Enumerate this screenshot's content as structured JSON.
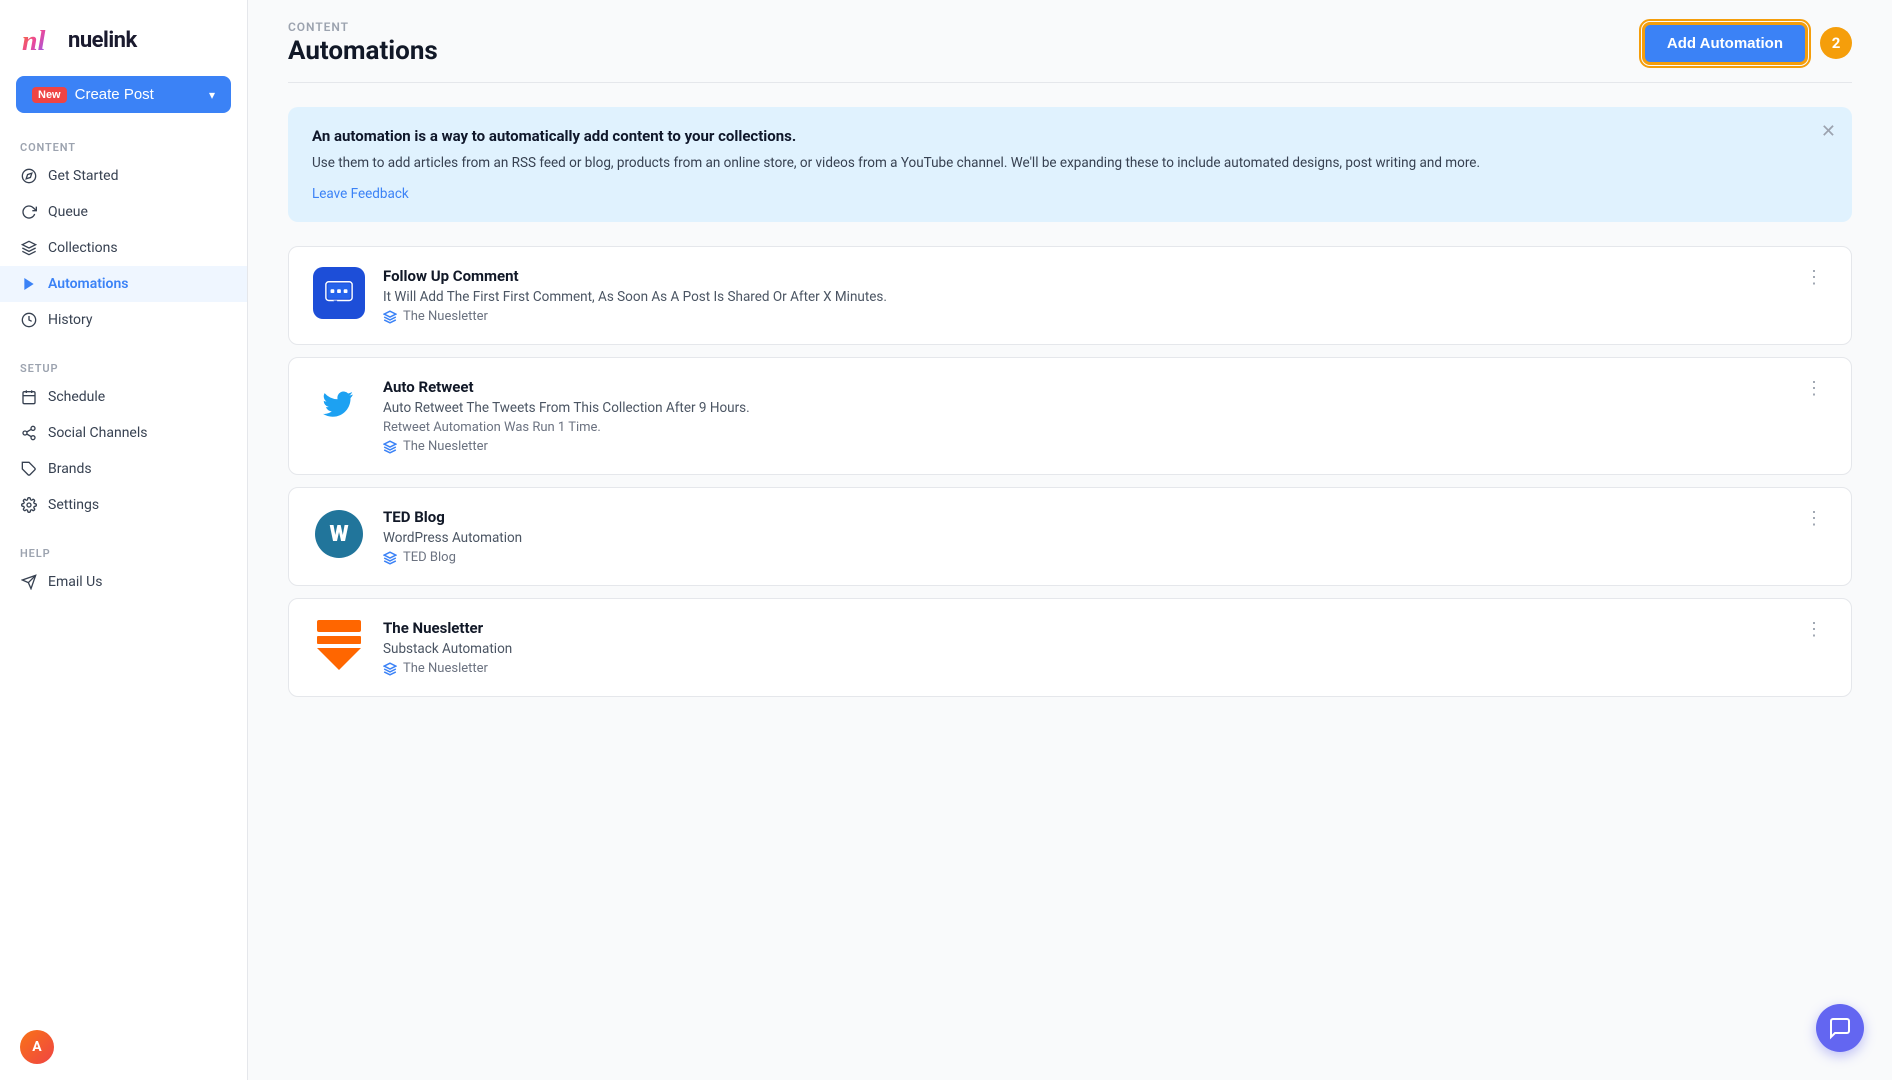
{
  "app": {
    "name": "nuelink",
    "logo_letters": "nl"
  },
  "sidebar": {
    "create_post_badge": "New",
    "create_post_label": "Create Post",
    "sections": [
      {
        "label": "CONTENT",
        "items": [
          {
            "id": "get-started",
            "label": "Get Started",
            "icon": "compass-icon"
          },
          {
            "id": "queue",
            "label": "Queue",
            "icon": "refresh-icon"
          },
          {
            "id": "collections",
            "label": "Collections",
            "icon": "layers-icon"
          },
          {
            "id": "automations",
            "label": "Automations",
            "icon": "play-icon",
            "active": true
          },
          {
            "id": "history",
            "label": "History",
            "icon": "clock-icon"
          }
        ]
      },
      {
        "label": "SETUP",
        "items": [
          {
            "id": "schedule",
            "label": "Schedule",
            "icon": "calendar-icon"
          },
          {
            "id": "social-channels",
            "label": "Social Channels",
            "icon": "share-icon"
          },
          {
            "id": "brands",
            "label": "Brands",
            "icon": "tag-icon"
          },
          {
            "id": "settings",
            "label": "Settings",
            "icon": "gear-icon"
          }
        ]
      },
      {
        "label": "HELP",
        "items": [
          {
            "id": "email-us",
            "label": "Email Us",
            "icon": "send-icon"
          }
        ]
      }
    ]
  },
  "header": {
    "content_label": "CONTENT",
    "page_title": "Automations",
    "add_automation_label": "Add Automation",
    "notification_count": "2"
  },
  "info_banner": {
    "title": "An automation is a way to automatically add content to your collections.",
    "description": "Use them to add articles from an RSS feed or blog, products from an online store, or videos from a YouTube channel. We'll be expanding these to include automated designs, post writing and more.",
    "link_label": "Leave Feedback"
  },
  "automations": [
    {
      "id": "follow-up-comment",
      "icon_type": "comment",
      "title": "Follow Up Comment",
      "description": "It Will Add The First First Comment, As Soon As A Post Is Shared Or After X Minutes.",
      "sub_text": "",
      "collection": "The Nuesletter"
    },
    {
      "id": "auto-retweet",
      "icon_type": "twitter",
      "title": "Auto Retweet",
      "description": "Auto Retweet The Tweets From This Collection After 9 Hours.",
      "sub_text": "Retweet Automation Was Run 1 Time.",
      "collection": "The Nuesletter"
    },
    {
      "id": "ted-blog",
      "icon_type": "wordpress",
      "title": "TED Blog",
      "description": "WordPress Automation",
      "sub_text": "",
      "collection": "TED Blog"
    },
    {
      "id": "the-nuesletter",
      "icon_type": "substack",
      "title": "The Nuesletter",
      "description": "Substack Automation",
      "sub_text": "",
      "collection": "The Nuesletter"
    }
  ],
  "chat_fab": {
    "icon": "chat-icon"
  }
}
